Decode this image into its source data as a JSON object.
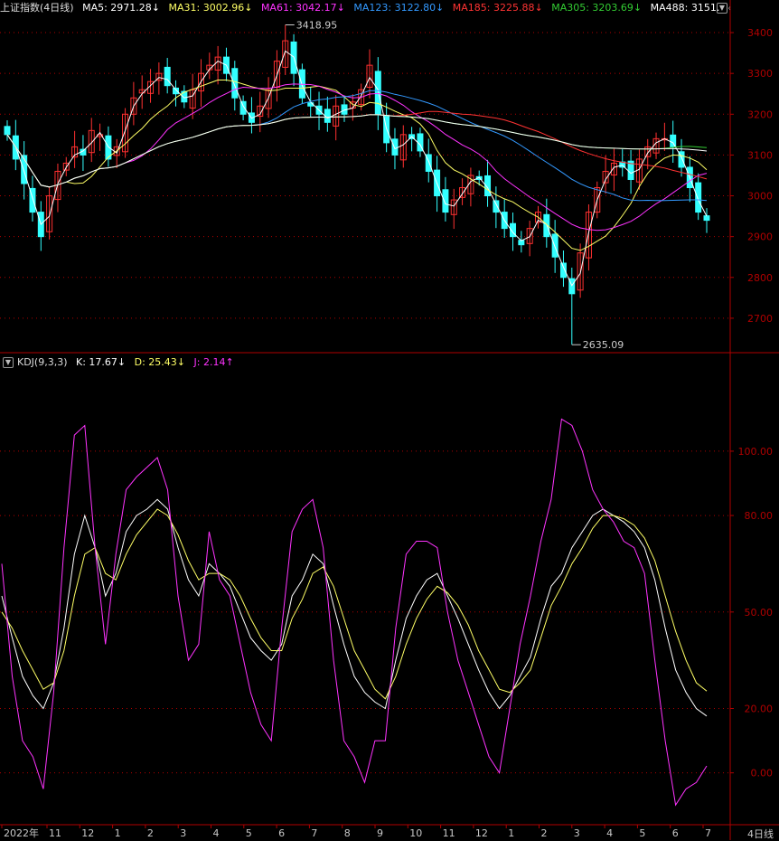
{
  "header": {
    "title": "上证指数(4日线)",
    "ma": [
      {
        "label": "MA5: 2971.28↓",
        "color": "#ffffff"
      },
      {
        "label": "MA31: 3002.96↓",
        "color": "#ffff66"
      },
      {
        "label": "MA61: 3042.17↓",
        "color": "#ff33ff"
      },
      {
        "label": "MA123: 3122.80↓",
        "color": "#3399ff"
      },
      {
        "label": "MA185: 3225.88↓",
        "color": "#ff3333"
      },
      {
        "label": "MA305: 3203.69↓",
        "color": "#33cc33"
      },
      {
        "label": "MA488: 3151.",
        "color": "#ffffff"
      }
    ],
    "diamond": "◇"
  },
  "kdj_header": {
    "title": "KDJ(9,3,3)",
    "k": "K: 17.67↓",
    "d": "D: 25.43↓",
    "j": "J: 2.14↑",
    "k_color": "#ffffff",
    "d_color": "#ffff66",
    "j_color": "#ff33ff"
  },
  "annotations": {
    "high": "3418.95",
    "low": "2635.09"
  },
  "price_axis": [
    "3400",
    "3300",
    "3200",
    "3100",
    "3000",
    "2900",
    "2800",
    "2700"
  ],
  "kdj_axis": [
    "100.00",
    "80.00",
    "50.00",
    "20.00",
    "0.00"
  ],
  "x_axis": [
    "2022年",
    "11",
    "12",
    "1",
    "2",
    "3",
    "4",
    "5",
    "6",
    "7",
    "8",
    "9",
    "10",
    "11",
    "12",
    "1",
    "2",
    "3",
    "4",
    "5",
    "6",
    "7"
  ],
  "corner_label": "4日线",
  "chart_data": [
    {
      "type": "candlestick",
      "title": "上证指数(4日线)",
      "ylim": [
        2620,
        3440
      ],
      "high": 3418.95,
      "low": 2635.09,
      "close_series": [
        3150,
        3090,
        3030,
        2960,
        2900,
        3000,
        3060,
        3080,
        3120,
        3100,
        3160,
        3150,
        3090,
        3120,
        3200,
        3240,
        3260,
        3280,
        3300,
        3270,
        3250,
        3230,
        3260,
        3300,
        3320,
        3340,
        3300,
        3240,
        3200,
        3180,
        3220,
        3260,
        3330,
        3380,
        3300,
        3240,
        3220,
        3200,
        3180,
        3220,
        3200,
        3230,
        3260,
        3320,
        3200,
        3130,
        3100,
        3150,
        3140,
        3110,
        3060,
        3000,
        2960,
        2990,
        3020,
        3050,
        3040,
        3000,
        2960,
        2920,
        2900,
        2880,
        2920,
        2960,
        2900,
        2850,
        2800,
        2760,
        2860,
        2960,
        3020,
        3060,
        3080,
        3070,
        3040,
        3090,
        3120,
        3140,
        3140,
        3120,
        3070,
        3020,
        2960,
        2940
      ]
    },
    {
      "type": "line",
      "title": "KDJ(9,3,3)",
      "ylim": [
        -15,
        125
      ],
      "series": [
        {
          "name": "K",
          "values": [
            55,
            42,
            30,
            24,
            20,
            28,
            45,
            68,
            80,
            70,
            55,
            62,
            75,
            80,
            82,
            85,
            82,
            70,
            60,
            55,
            65,
            62,
            58,
            50,
            42,
            38,
            35,
            40,
            55,
            60,
            68,
            65,
            52,
            40,
            30,
            25,
            22,
            20,
            35,
            48,
            55,
            60,
            62,
            55,
            48,
            40,
            32,
            25,
            20,
            24,
            30,
            36,
            48,
            58,
            62,
            70,
            75,
            80,
            82,
            80,
            78,
            75,
            70,
            60,
            45,
            32,
            25,
            20,
            17.67
          ]
        },
        {
          "name": "D",
          "values": [
            50,
            45,
            38,
            32,
            26,
            28,
            38,
            55,
            68,
            70,
            62,
            60,
            68,
            74,
            78,
            82,
            80,
            74,
            66,
            60,
            62,
            62,
            60,
            55,
            48,
            42,
            38,
            38,
            48,
            54,
            62,
            64,
            58,
            48,
            38,
            32,
            26,
            23,
            30,
            40,
            48,
            54,
            58,
            56,
            52,
            46,
            38,
            32,
            26,
            25,
            28,
            32,
            42,
            52,
            58,
            65,
            70,
            76,
            80,
            80,
            79,
            77,
            73,
            66,
            55,
            44,
            35,
            28,
            25.43
          ]
        },
        {
          "name": "J",
          "values": [
            65,
            30,
            10,
            5,
            -5,
            25,
            70,
            105,
            108,
            70,
            40,
            68,
            88,
            92,
            95,
            98,
            88,
            55,
            35,
            40,
            75,
            60,
            55,
            40,
            25,
            15,
            10,
            45,
            75,
            82,
            85,
            70,
            35,
            10,
            5,
            -3,
            10,
            10,
            45,
            68,
            72,
            72,
            70,
            50,
            35,
            25,
            15,
            5,
            0,
            20,
            40,
            55,
            72,
            85,
            110,
            108,
            100,
            88,
            82,
            78,
            72,
            70,
            62,
            35,
            10,
            -10,
            -5,
            -3,
            2.14
          ]
        }
      ]
    }
  ]
}
